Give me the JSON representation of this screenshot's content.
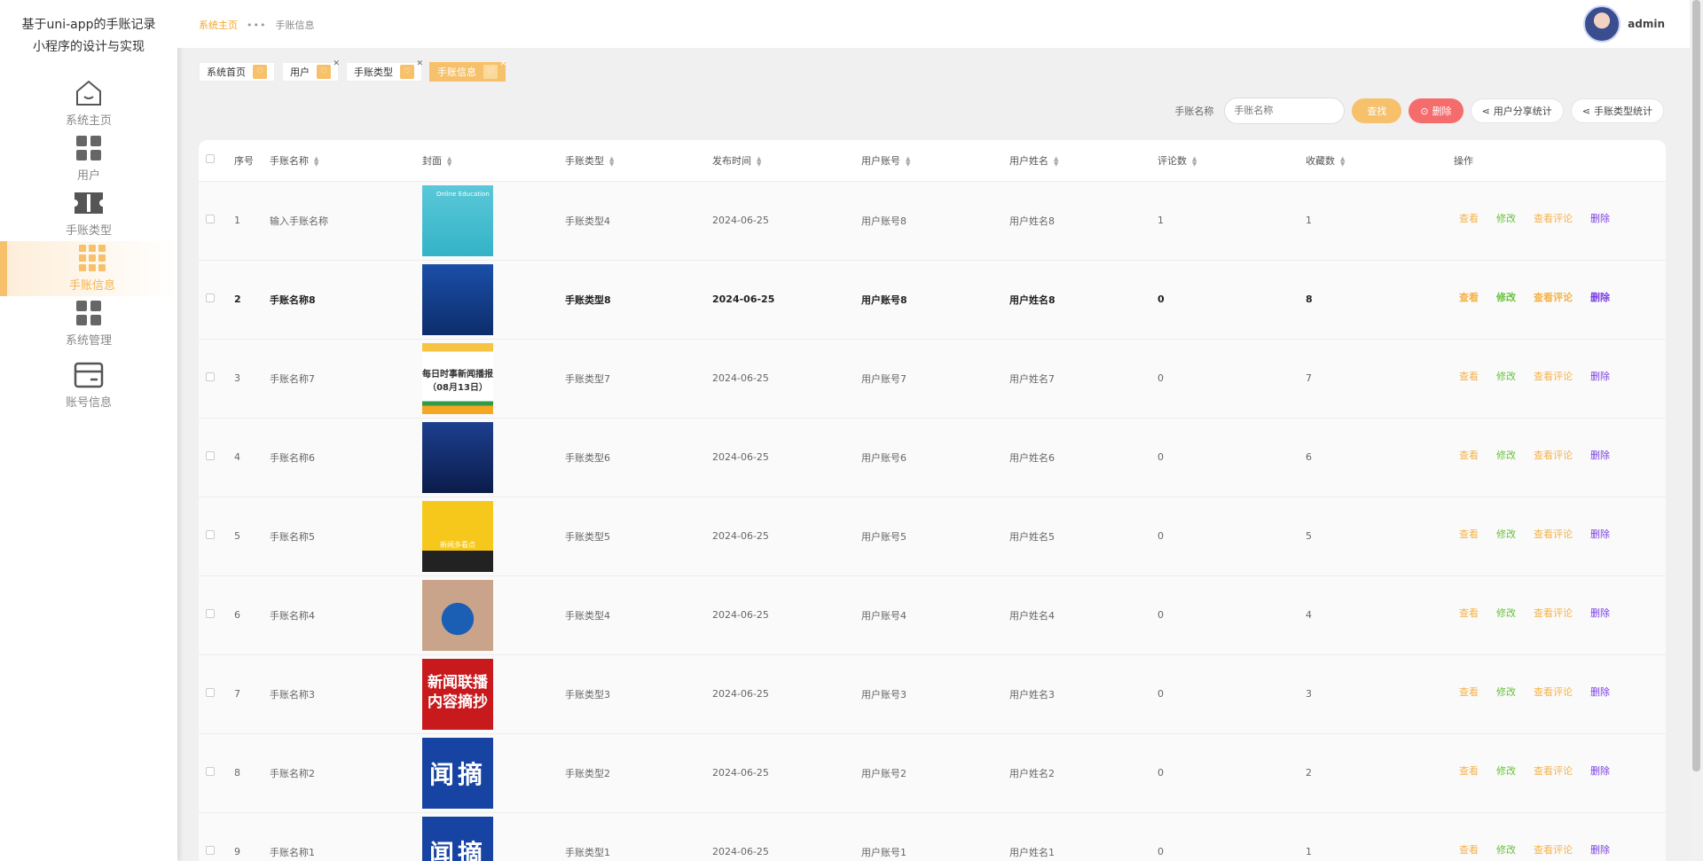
{
  "brand": {
    "line1": "基于uni-app的手账记录",
    "line2": "小程序的设计与实现"
  },
  "menu": [
    {
      "label": "系统主页",
      "icon": "home-icon"
    },
    {
      "label": "用户",
      "icon": "grid-icon"
    },
    {
      "label": "手账类型",
      "icon": "ticket-icon"
    },
    {
      "label": "手账信息",
      "icon": "grid-nine-icon",
      "active": true
    },
    {
      "label": "系统管理",
      "icon": "grid-icon"
    },
    {
      "label": "账号信息",
      "icon": "card-icon"
    }
  ],
  "breadcrumb": {
    "home": "系统主页",
    "current": "手账信息"
  },
  "user": {
    "name": "admin"
  },
  "tags": [
    {
      "label": "系统首页"
    },
    {
      "label": "用户"
    },
    {
      "label": "手账类型"
    },
    {
      "label": "手账信息",
      "active": true
    }
  ],
  "search": {
    "label": "手账名称",
    "placeholder": "手账名称",
    "find": "查找",
    "delete": "删除",
    "share_stats": "用户分享统计",
    "type_stats": "手账类型统计"
  },
  "table": {
    "headers": [
      "序号",
      "手账名称",
      "封面",
      "手账类型",
      "发布时间",
      "用户账号",
      "用户姓名",
      "评论数",
      "收藏数",
      "操作"
    ],
    "actions": {
      "view": "查看",
      "edit": "修改",
      "comments": "查看评论",
      "delete": "删除"
    },
    "rows": [
      {
        "no": "1",
        "name": "输入手账名称",
        "type": "手账类型4",
        "date": "2024-06-25",
        "account": "用户账号8",
        "username": "用户姓名8",
        "comments": "1",
        "favs": "1"
      },
      {
        "no": "2",
        "name": "手账名称8",
        "type": "手账类型8",
        "date": "2024-06-25",
        "account": "用户账号8",
        "username": "用户姓名8",
        "comments": "0",
        "favs": "8"
      },
      {
        "no": "3",
        "name": "手账名称7",
        "type": "手账类型7",
        "date": "2024-06-25",
        "account": "用户账号7",
        "username": "用户姓名7",
        "comments": "0",
        "favs": "7"
      },
      {
        "no": "4",
        "name": "手账名称6",
        "type": "手账类型6",
        "date": "2024-06-25",
        "account": "用户账号6",
        "username": "用户姓名6",
        "comments": "0",
        "favs": "6"
      },
      {
        "no": "5",
        "name": "手账名称5",
        "type": "手账类型5",
        "date": "2024-06-25",
        "account": "用户账号5",
        "username": "用户姓名5",
        "comments": "0",
        "favs": "5"
      },
      {
        "no": "6",
        "name": "手账名称4",
        "type": "手账类型4",
        "date": "2024-06-25",
        "account": "用户账号4",
        "username": "用户姓名4",
        "comments": "0",
        "favs": "4"
      },
      {
        "no": "7",
        "name": "手账名称3",
        "type": "手账类型3",
        "date": "2024-06-25",
        "account": "用户账号3",
        "username": "用户姓名3",
        "comments": "0",
        "favs": "3"
      },
      {
        "no": "8",
        "name": "手账名称2",
        "type": "手账类型2",
        "date": "2024-06-25",
        "account": "用户账号2",
        "username": "用户姓名2",
        "comments": "0",
        "favs": "2"
      },
      {
        "no": "9",
        "name": "手账名称1",
        "type": "手账类型1",
        "date": "2024-06-25",
        "account": "用户账号1",
        "username": "用户姓名1",
        "comments": "0",
        "favs": "1"
      }
    ]
  },
  "covers": [
    {
      "text1": "Online Education",
      "text2": ""
    },
    {
      "text1": "",
      "text2": ""
    },
    {
      "text1": "每日时事新闻播报",
      "text2": "（08月13日）"
    },
    {
      "text1": "",
      "text2": ""
    },
    {
      "text1": "新闻多看点",
      "text2": ""
    },
    {
      "text1": "",
      "text2": ""
    },
    {
      "text1": "新闻联播",
      "text2": "内容摘抄"
    },
    {
      "text1": "闻摘",
      "text2": ""
    },
    {
      "text1": "闻摘",
      "text2": ""
    }
  ],
  "colors": {
    "accent": "#f6c16a",
    "danger": "#f56c6c",
    "edit": "#67c23a",
    "delete_link": "#7b3fe4"
  }
}
